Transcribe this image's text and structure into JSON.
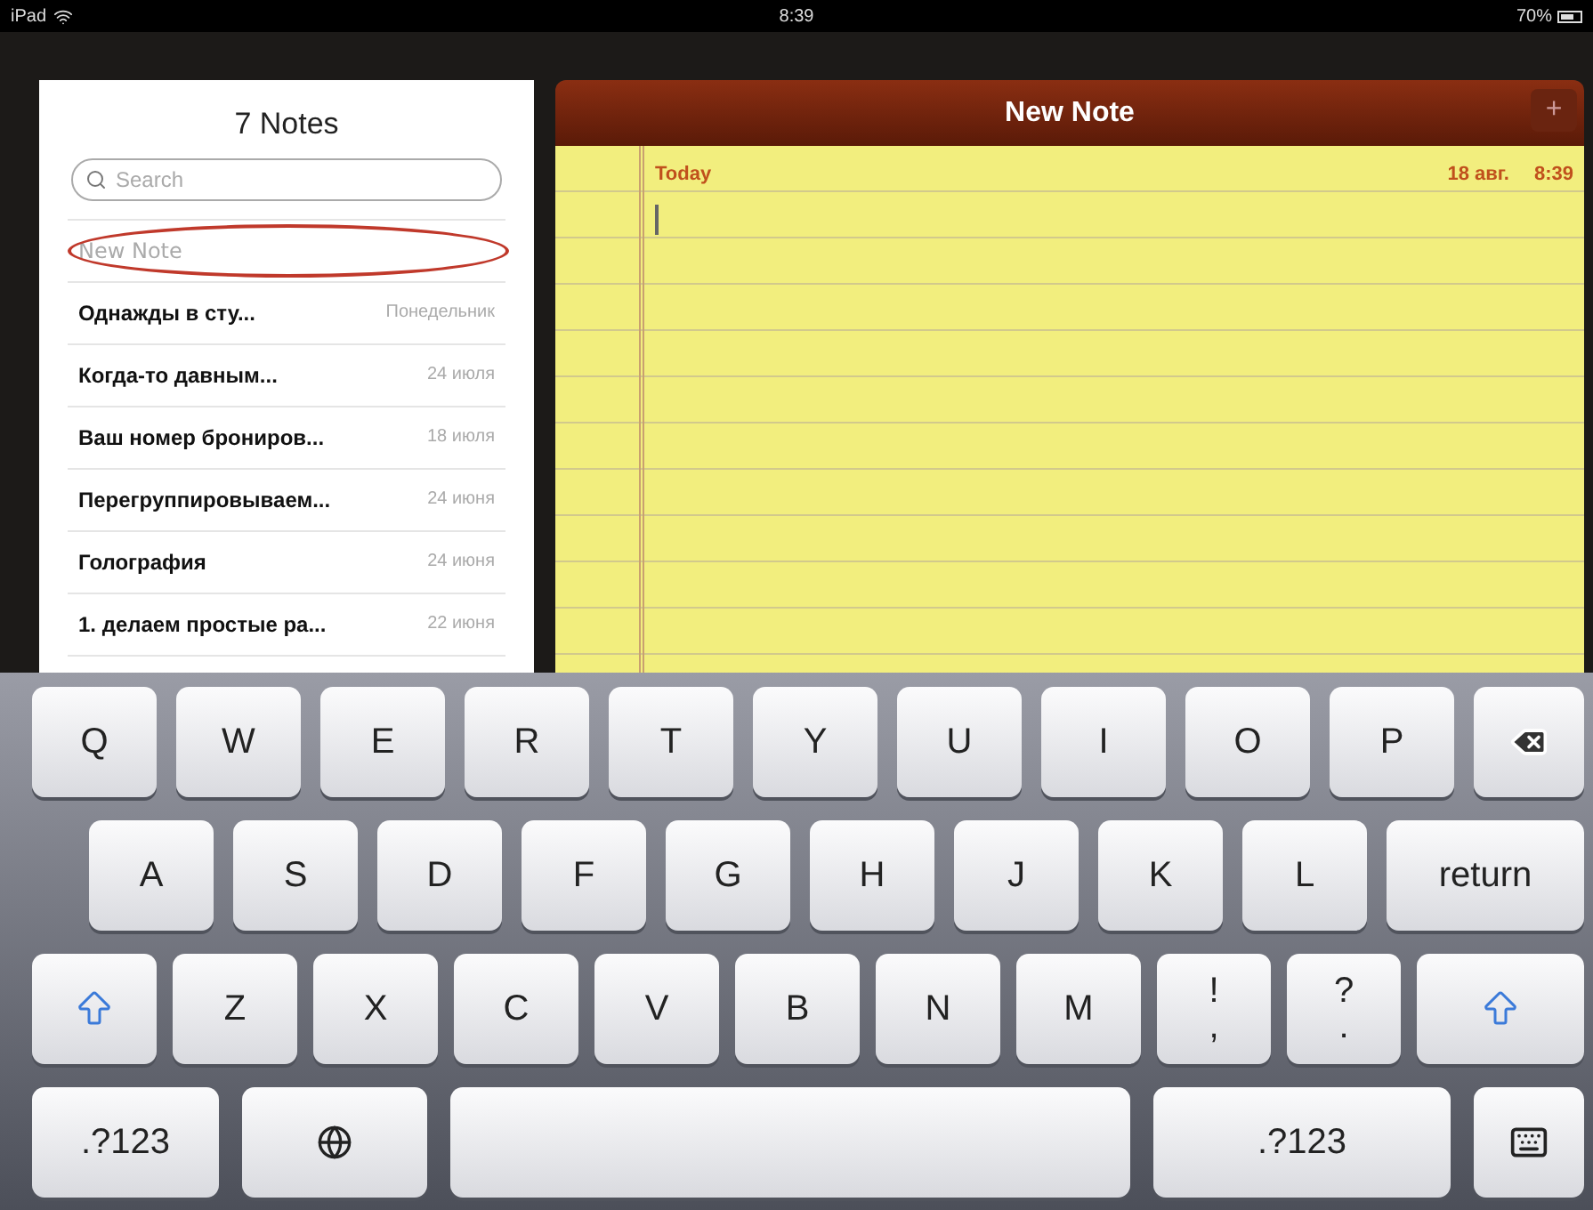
{
  "status_bar": {
    "device": "iPad",
    "time": "8:39",
    "battery": "70%"
  },
  "notes_list": {
    "title": "7 Notes",
    "search": {
      "placeholder": "Search"
    },
    "items": [
      {
        "title": "New Note",
        "placeholder": true,
        "circled": true
      },
      {
        "title": "Однажды в сту...",
        "date": "Понедельник",
        "placeholder": false,
        "circled": false
      },
      {
        "title": "Когда-то давным...",
        "date": "24 июля",
        "placeholder": false,
        "circled": false
      },
      {
        "title": "Ваш номер брониров...",
        "date": "18 июля",
        "placeholder": false,
        "circled": false
      },
      {
        "title": "Перегруппировываем...",
        "date": "24 июня",
        "placeholder": false,
        "circled": false
      },
      {
        "title": "Голография",
        "date": "24 июня",
        "placeholder": false,
        "circled": false
      },
      {
        "title": "1. делаем простые ра...",
        "date": "22 июня",
        "placeholder": false,
        "circled": false
      }
    ]
  },
  "note": {
    "title": "New Note",
    "add_button": "+",
    "day": "Today",
    "date": "18 авг.",
    "time": "8:39"
  },
  "keyboard": {
    "rows": [
      [
        {
          "kind": "char",
          "label": "Q"
        },
        {
          "kind": "char",
          "label": "W"
        },
        {
          "kind": "char",
          "label": "E"
        },
        {
          "kind": "char",
          "label": "R"
        },
        {
          "kind": "char",
          "label": "T"
        },
        {
          "kind": "char",
          "label": "Y"
        },
        {
          "kind": "char",
          "label": "U"
        },
        {
          "kind": "char",
          "label": "I"
        },
        {
          "kind": "char",
          "label": "O"
        },
        {
          "kind": "char",
          "label": "P"
        },
        {
          "kind": "backspace"
        }
      ],
      [
        {
          "kind": "char",
          "label": "A"
        },
        {
          "kind": "char",
          "label": "S"
        },
        {
          "kind": "char",
          "label": "D"
        },
        {
          "kind": "char",
          "label": "F"
        },
        {
          "kind": "char",
          "label": "G"
        },
        {
          "kind": "char",
          "label": "H"
        },
        {
          "kind": "char",
          "label": "J"
        },
        {
          "kind": "char",
          "label": "K"
        },
        {
          "kind": "char",
          "label": "L"
        },
        {
          "kind": "return",
          "label": "return"
        }
      ],
      [
        {
          "kind": "shift"
        },
        {
          "kind": "char",
          "label": "Z"
        },
        {
          "kind": "char",
          "label": "X"
        },
        {
          "kind": "char",
          "label": "C"
        },
        {
          "kind": "char",
          "label": "V"
        },
        {
          "kind": "char",
          "label": "B"
        },
        {
          "kind": "char",
          "label": "N"
        },
        {
          "kind": "char",
          "label": "M"
        },
        {
          "kind": "char",
          "label": "!",
          "sublabel": ","
        },
        {
          "kind": "char",
          "label": "?",
          "sublabel": "."
        },
        {
          "kind": "shift"
        }
      ],
      [
        {
          "kind": "numbers",
          "label": ".?123"
        },
        {
          "kind": "globe"
        },
        {
          "kind": "space"
        },
        {
          "kind": "numbers",
          "label": ".?123"
        },
        {
          "kind": "hide"
        }
      ]
    ]
  }
}
